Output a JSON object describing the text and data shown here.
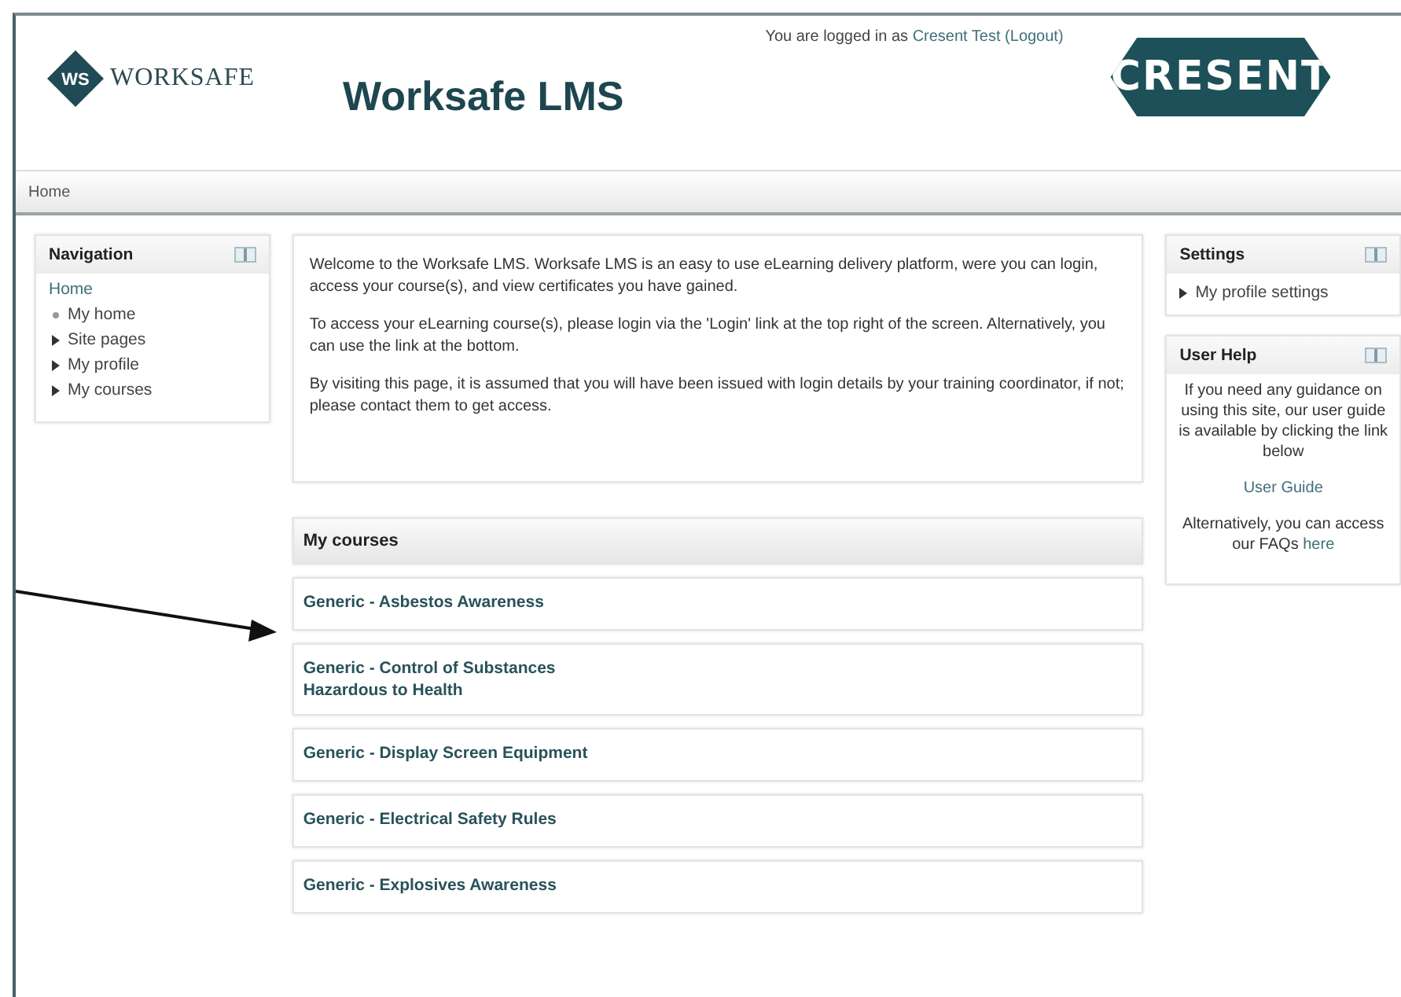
{
  "header": {
    "brand": "WORKSAFE",
    "brand_mark": "WS",
    "title": "Worksafe LMS",
    "login_prefix": "You are logged in as",
    "user": "Cresent Test",
    "logout": "(Logout)",
    "client_logo": "CRESENT"
  },
  "breadcrumb": [
    "Home"
  ],
  "navigation": {
    "title": "Navigation",
    "root": "Home",
    "items": [
      {
        "label": "My home",
        "kind": "leaf"
      },
      {
        "label": "Site pages",
        "kind": "branch"
      },
      {
        "label": "My profile",
        "kind": "branch"
      },
      {
        "label": "My courses",
        "kind": "branch"
      }
    ]
  },
  "welcome": [
    "Welcome to the Worksafe LMS.  Worksafe LMS is an easy to use eLearning delivery platform, were you can login, access your course(s), and view certificates you have gained.",
    "To access your eLearning course(s), please login via the 'Login' link at the top right of the screen. Alternatively, you can use the link at the bottom.",
    "By visiting this page, it is assumed that you will have been issued with login details by your training coordinator, if not; please contact them to get access."
  ],
  "my_courses": {
    "title": "My courses",
    "courses": [
      {
        "name": "Generic - Asbestos Awareness"
      },
      {
        "name": "Generic - Control of Substances Hazardous to Health"
      },
      {
        "name": "Generic - Display Screen Equipment"
      },
      {
        "name": "Generic - Electrical Safety Rules"
      },
      {
        "name": "Generic - Explosives Awareness"
      }
    ]
  },
  "settings": {
    "title": "Settings",
    "items": [
      "My profile settings"
    ]
  },
  "user_help": {
    "title": "User Help",
    "text": "If you need any guidance on using this site, our user guide is available by clicking the link below",
    "link": "User Guide",
    "faq_prefix": "Alternatively, you can access our FAQs",
    "faq_link": "here"
  }
}
